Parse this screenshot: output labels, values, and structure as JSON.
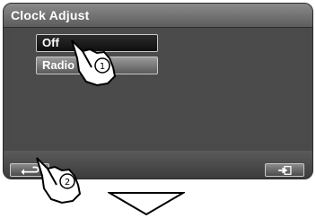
{
  "window": {
    "title": "Clock Adjust"
  },
  "options": [
    {
      "label": "Off",
      "selected": true
    },
    {
      "label": "Radio",
      "selected": false
    }
  ],
  "navigation": {
    "back_icon": "back-arrow-icon",
    "exit_icon": "exit-icon"
  },
  "annotations": {
    "step1": "1",
    "step2": "2"
  },
  "colors": {
    "screen_bg": "#4a4a4a",
    "selected_bg": "#111111",
    "unselected_bg": "#7a7a7a",
    "border": "#c9c9c9"
  }
}
